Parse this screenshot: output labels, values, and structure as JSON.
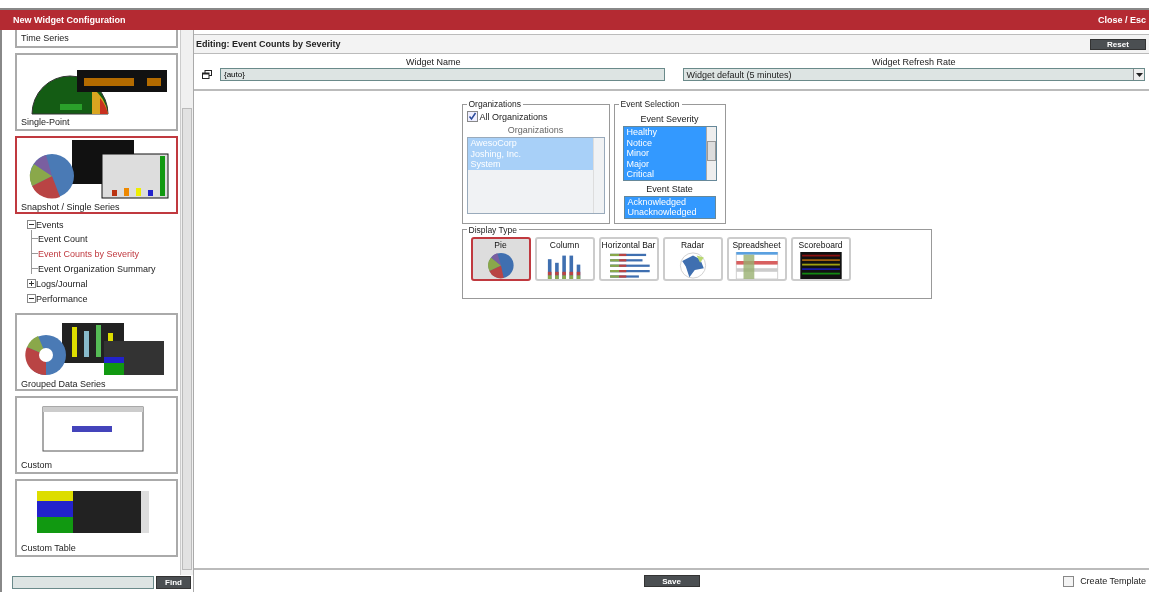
{
  "window": {
    "title": "New Widget Configuration",
    "close": "Close / Esc"
  },
  "sidebar": {
    "categories": [
      {
        "label": "Time Series",
        "kind": "cut",
        "selected": false
      },
      {
        "label": "Single-Point",
        "kind": "gauge",
        "selected": false
      },
      {
        "label": "Snapshot / Single Series",
        "kind": "pie",
        "selected": true,
        "children": [
          {
            "label": "Events",
            "expanded": true,
            "selected": false,
            "children": [
              {
                "label": "Event Count",
                "selected": false
              },
              {
                "label": "Event Counts by Severity",
                "selected": true
              },
              {
                "label": "Event Organization Summary",
                "selected": false
              }
            ]
          },
          {
            "label": "Logs/Journal",
            "expanded": false,
            "selected": false
          },
          {
            "label": "Performance",
            "expanded": true,
            "selected": false
          }
        ]
      },
      {
        "label": "Grouped Data Series",
        "kind": "grouped",
        "selected": false
      },
      {
        "label": "Custom",
        "kind": "browser",
        "selected": false
      },
      {
        "label": "Custom Table",
        "kind": "table",
        "selected": false
      }
    ],
    "search_button": "Find"
  },
  "editor": {
    "title": "Editing: Event Counts by Severity",
    "reset": "Reset",
    "widget_name": {
      "label": "Widget Name",
      "value": "{auto}"
    },
    "refresh_rate": {
      "label": "Widget Refresh Rate",
      "value": "Widget default (5 minutes)"
    }
  },
  "organizations": {
    "legend": "Organizations",
    "all": {
      "label": "All Organizations",
      "checked": true
    },
    "list_label": "Organizations",
    "items": [
      {
        "label": "AwesoCorp",
        "selected": true
      },
      {
        "label": "Joshing, Inc.",
        "selected": true
      },
      {
        "label": "System",
        "selected": true
      }
    ]
  },
  "event_selection": {
    "legend": "Event Selection",
    "severity_label": "Event Severity",
    "severities": [
      {
        "label": "Healthy",
        "selected": true
      },
      {
        "label": "Notice",
        "selected": true
      },
      {
        "label": "Minor",
        "selected": true
      },
      {
        "label": "Major",
        "selected": true
      },
      {
        "label": "Critical",
        "selected": true
      }
    ],
    "state_label": "Event State",
    "states": [
      {
        "label": "Acknowledged",
        "selected": true
      },
      {
        "label": "Unacknowledged",
        "selected": true
      }
    ]
  },
  "display_type": {
    "legend": "Display Type",
    "options": [
      {
        "label": "Pie",
        "kind": "pie",
        "selected": true
      },
      {
        "label": "Column",
        "kind": "column",
        "selected": false
      },
      {
        "label": "Horizontal Bar",
        "kind": "hbar",
        "selected": false
      },
      {
        "label": "Radar",
        "kind": "radar",
        "selected": false
      },
      {
        "label": "Spreadsheet",
        "kind": "spreadsheet",
        "selected": false
      },
      {
        "label": "Scoreboard",
        "kind": "scoreboard",
        "selected": false
      }
    ]
  },
  "footer": {
    "save": "Save",
    "template": {
      "label": "Create Template",
      "checked": false
    }
  }
}
